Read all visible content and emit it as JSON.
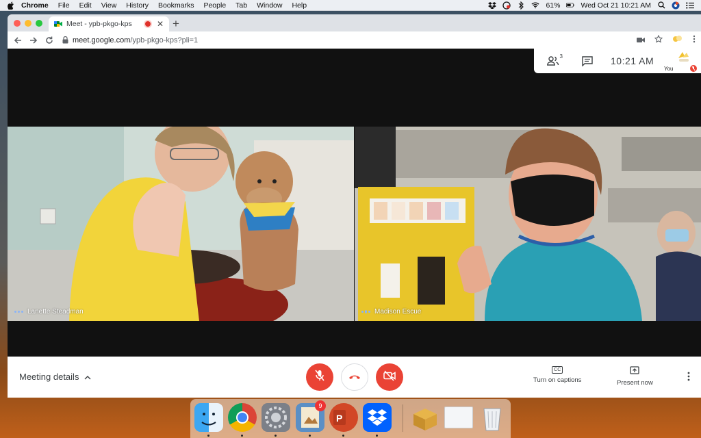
{
  "menubar": {
    "app": "Chrome",
    "items": [
      "File",
      "Edit",
      "View",
      "History",
      "Bookmarks",
      "People",
      "Tab",
      "Window",
      "Help"
    ],
    "battery": "61%",
    "datetime": "Wed Oct 21  10:21 AM"
  },
  "browser": {
    "tab_title": "Meet - ypb-pkgo-kps",
    "url_host": "meet.google.com",
    "url_path": "/ypb-pkgo-kps?pli=1"
  },
  "meet": {
    "participants_count": "3",
    "clock": "10:21  AM",
    "self_label": "You",
    "participants": [
      {
        "name": "Lanette Steadman"
      },
      {
        "name": "Madison Escue"
      }
    ],
    "meeting_details": "Meeting details",
    "captions_label": "Turn on captions",
    "present_label": "Present now",
    "captions_icon": "CC"
  },
  "dock": {
    "apps": [
      "finder",
      "chrome",
      "system-preferences",
      "preview",
      "powerpoint",
      "dropbox",
      "archive-utility",
      "blank-window",
      "trash"
    ],
    "preview_badge": "9"
  },
  "colors": {
    "meet_red": "#ea4335",
    "chrome_tab_bg": "#dee1e6"
  }
}
